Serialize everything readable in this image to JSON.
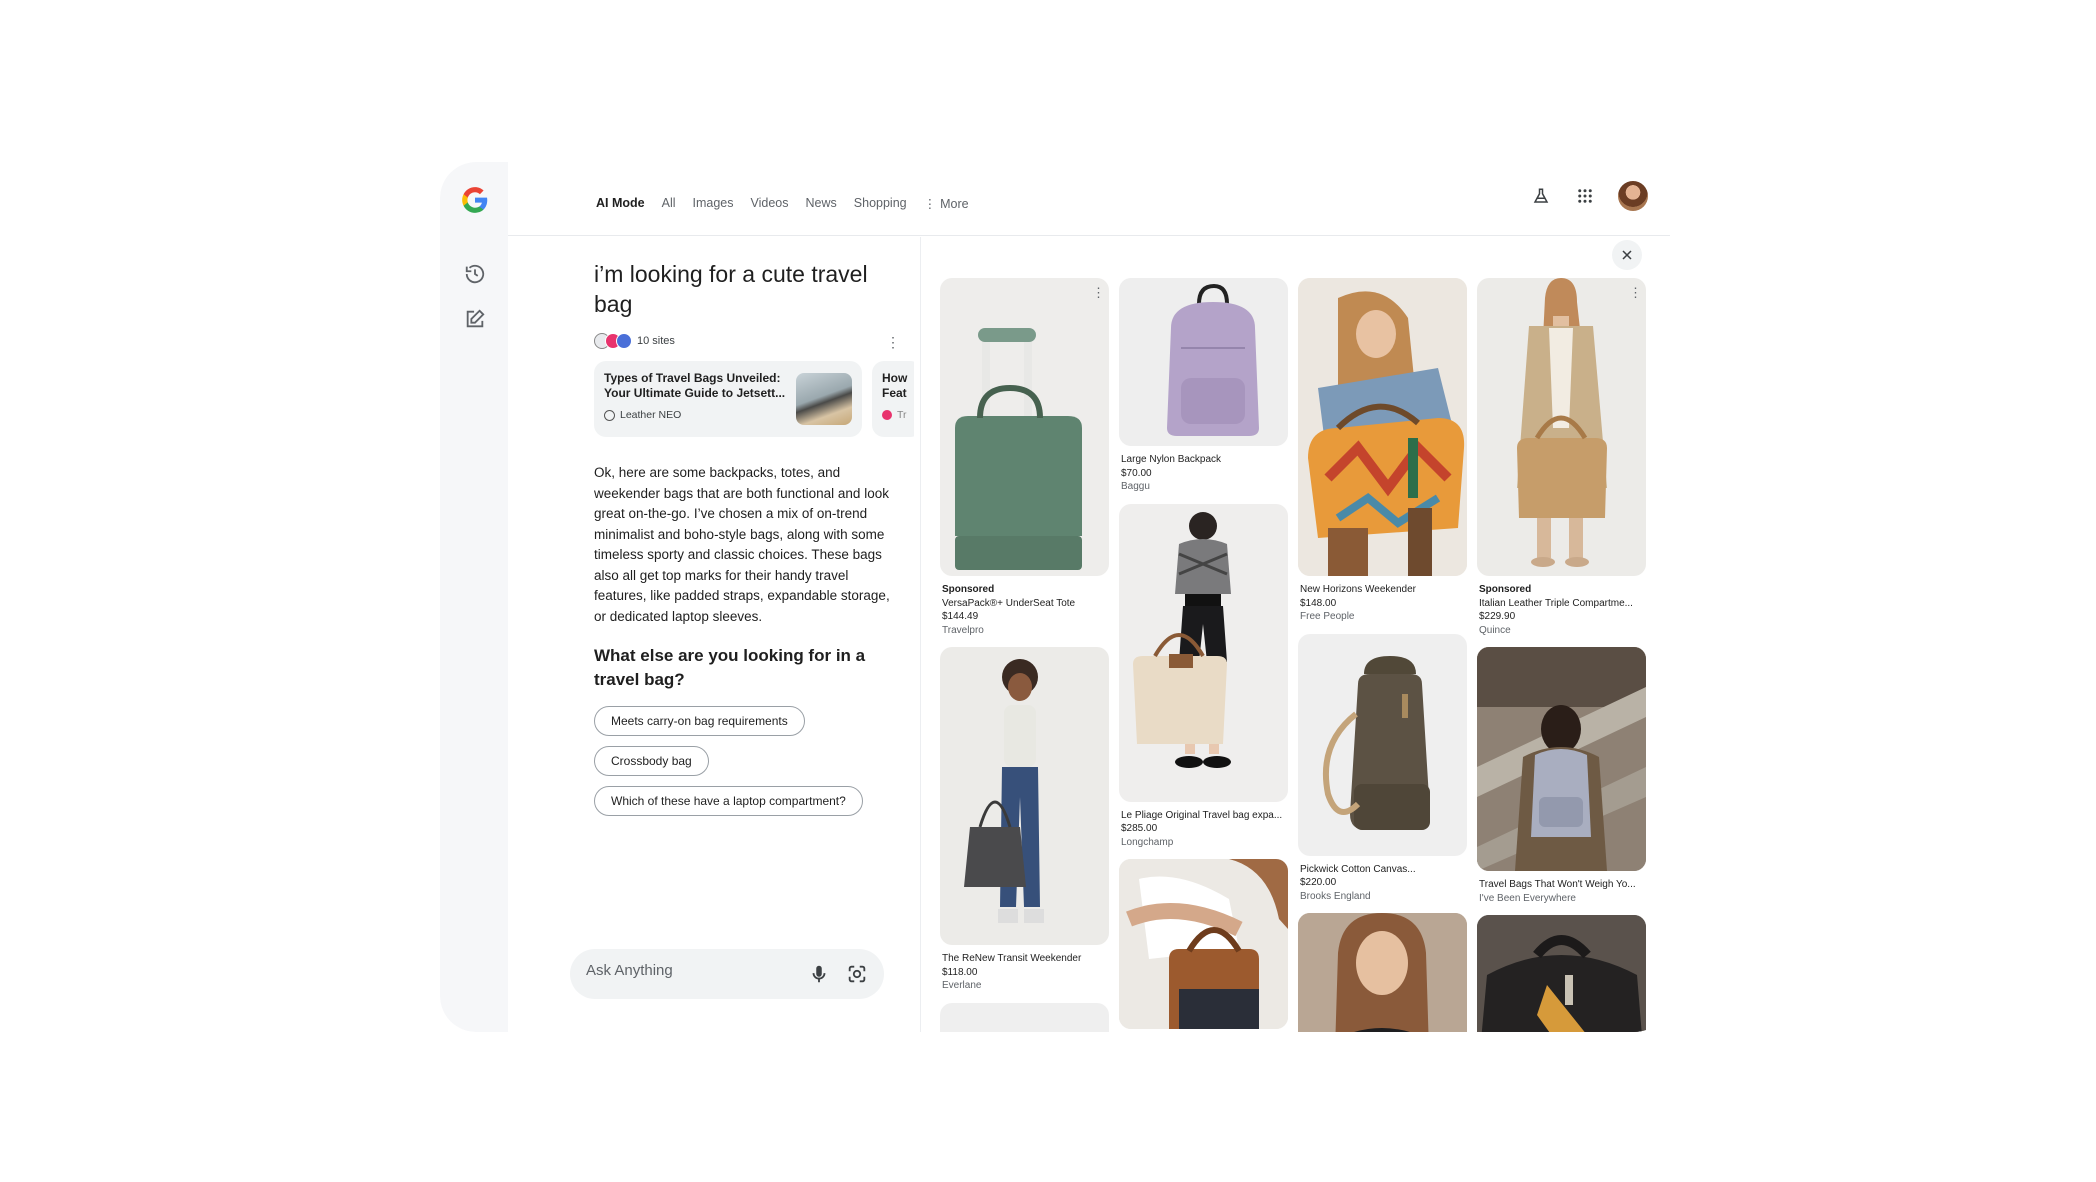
{
  "nav": {
    "tabs": [
      "AI Mode",
      "All",
      "Images",
      "Videos",
      "News",
      "Shopping"
    ],
    "more_label": "More"
  },
  "query": "i’m looking for a cute travel bag",
  "sources": {
    "count_label": "10 sites",
    "cards": [
      {
        "title": "Types of Travel Bags Unveiled: Your Ultimate Guide to Jetsett...",
        "source": "Leather NEO"
      },
      {
        "title": "How Feat",
        "source": "Tr"
      }
    ]
  },
  "answer": "Ok, here are some backpacks, totes, and weekender bags that are both functional and look great on-the-go. I’ve chosen a mix of on-trend minimalist and boho-style bags, along with some timeless sporty and classic choices. These bags also all get top marks for their handy travel features, like padded straps, expandable storage, or dedicated laptop sleeves.",
  "followup_question": "What else are you looking for in a travel bag?",
  "chips": [
    "Meets carry-on bag requirements",
    "Crossbody bag",
    "Which of these have a laptop compartment?"
  ],
  "ask_bar": {
    "placeholder": "Ask Anything"
  },
  "products": {
    "col1": [
      {
        "sponsored": "Sponsored",
        "name": "VersaPack®+ UnderSeat Tote",
        "price": "$144.49",
        "merchant": "Travelpro"
      },
      {
        "name": "The ReNew Transit Weekender",
        "price": "$118.00",
        "merchant": "Everlane"
      }
    ],
    "col2": [
      {
        "name": "Large Nylon Backpack",
        "price": "$70.00",
        "merchant": "Baggu"
      },
      {
        "name": "Le Pliage Original Travel bag expa...",
        "price": "$285.00",
        "merchant": "Longchamp"
      }
    ],
    "col3": [
      {
        "name": "New Horizons Weekender",
        "price": "$148.00",
        "merchant": "Free People"
      },
      {
        "name": "Pickwick Cotton Canvas...",
        "price": "$220.00",
        "merchant": "Brooks England"
      }
    ],
    "col4": [
      {
        "sponsored": "Sponsored",
        "name": "Italian Leather Triple Compartme...",
        "price": "$229.90",
        "merchant": "Quince"
      },
      {
        "name": "Travel Bags That Won't Weigh Yo...",
        "price": "",
        "merchant": "I've Been Everywhere"
      }
    ]
  },
  "colors": {
    "accent": "#1a73e8",
    "text": "#1f1f1f",
    "muted": "#5f6368",
    "surface": "#f1f3f4"
  }
}
